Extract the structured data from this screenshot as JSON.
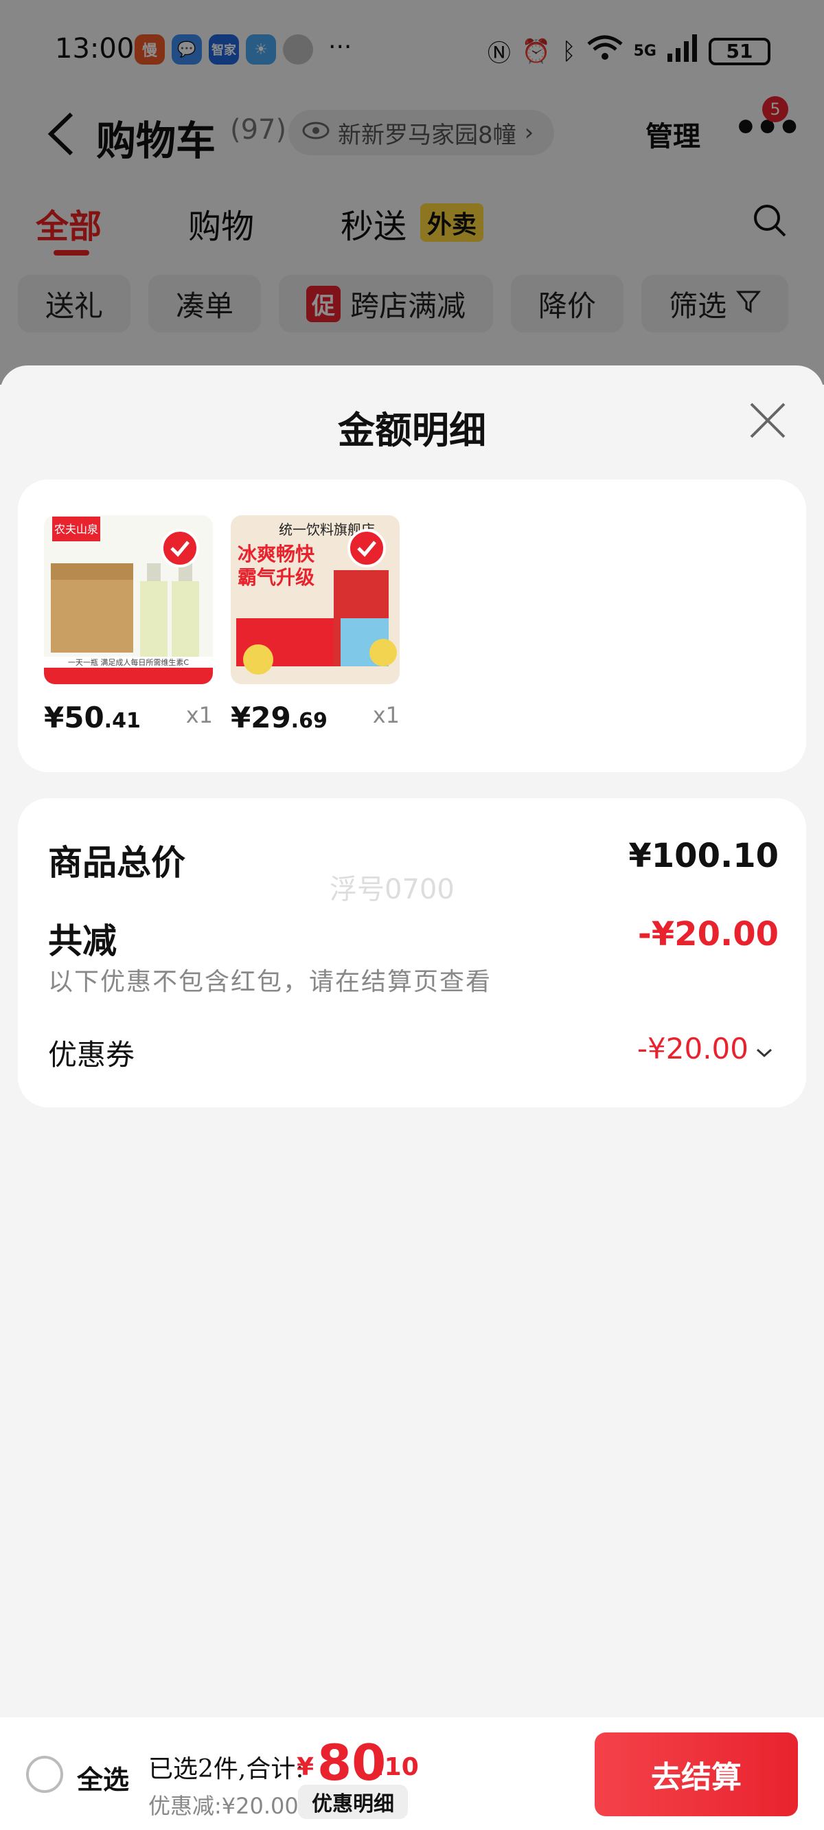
{
  "status_bar": {
    "time": "13:00",
    "apps": [
      {
        "label": "慢",
        "color": "#f05a28"
      },
      {
        "label": "💬",
        "color": "#3c8cf0"
      },
      {
        "label": "智家",
        "color": "#2266dd"
      },
      {
        "label": "☀",
        "color": "#4aa8f0"
      },
      {
        "label": "",
        "color": "#c0c0c0"
      }
    ],
    "more": "···",
    "network": "5G",
    "battery": "51"
  },
  "header": {
    "title": "购物车",
    "count": "(97)",
    "address": "新新罗马家园8幢",
    "manage": "管理",
    "more_dots": "•••",
    "notification_badge": "5"
  },
  "tabs": [
    {
      "label": "全部",
      "active": true
    },
    {
      "label": "购物",
      "active": false
    },
    {
      "label": "秒送",
      "active": false
    }
  ],
  "tab_badge": "外卖",
  "chips": [
    {
      "label": "送礼"
    },
    {
      "label": "凑单"
    },
    {
      "label": "跨店满减",
      "tag": "促"
    },
    {
      "label": "降价"
    },
    {
      "label": "筛选"
    }
  ],
  "sheet": {
    "title": "金额明细",
    "products": [
      {
        "price_main": "¥50",
        "price_cents": ".41",
        "qty": "x1",
        "img_brand": "农夫山泉",
        "img_caption": "一天一瓶 满足成人每日所需维生素C"
      },
      {
        "price_main": "¥29",
        "price_cents": ".69",
        "qty": "x1",
        "img_store": "统一饮料旗舰店",
        "img_headline": "冰爽畅快 霸气升级"
      }
    ],
    "summary": {
      "total_label": "商品总价",
      "total_value": "¥100.10",
      "reduce_label": "共减",
      "reduce_value": "-¥20.00",
      "note": "以下优惠不包含红包，请在结算页查看",
      "coupon_label": "优惠券",
      "coupon_value": "-¥20.00",
      "watermark": "浮号0700"
    }
  },
  "bottom_bar": {
    "select_all": "全选",
    "selected_text": "已选2件,合计:",
    "total_yen": "¥",
    "total_main": "80",
    "total_cents": ".10",
    "discount_text": "优惠减:¥20.00",
    "detail_button": "优惠明细",
    "checkout_button": "去结算"
  },
  "colors": {
    "accent_red": "#e8232e",
    "tag_yellow": "#ffd83d"
  }
}
